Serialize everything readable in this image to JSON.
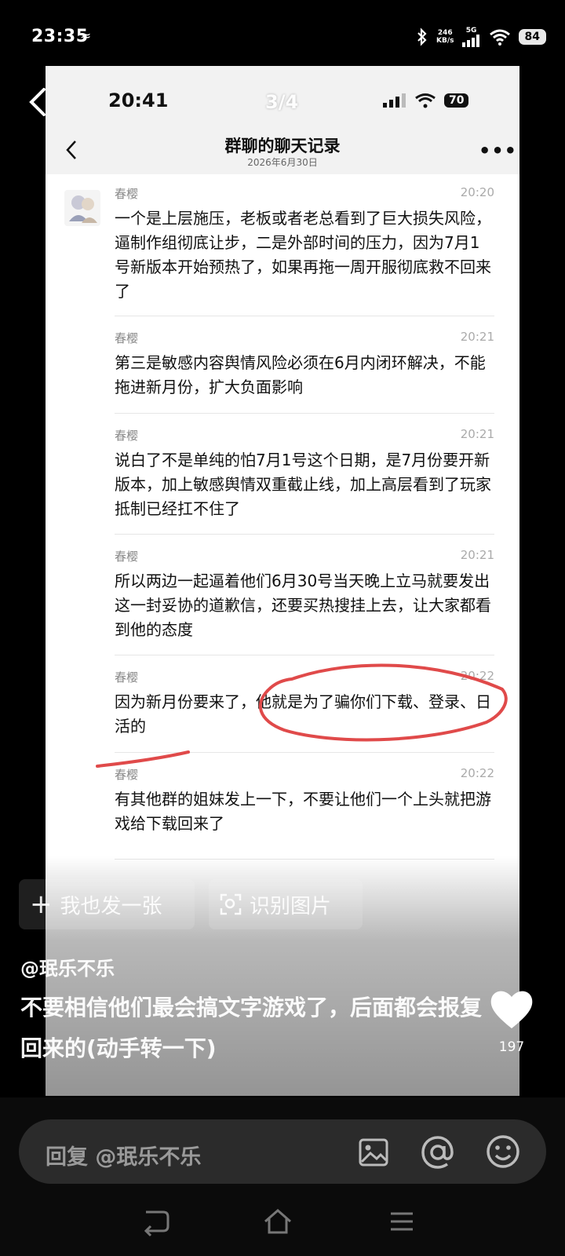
{
  "status_bar": {
    "time": "23:35",
    "flag": "≈",
    "speed_value": "246",
    "speed_unit": "KB/s",
    "network": "5G",
    "battery": "84"
  },
  "shot": {
    "status": {
      "time": "20:41",
      "battery": "70"
    },
    "page_indicator": "3/4",
    "title": "群聊的聊天记录",
    "date": "2026年6月30日",
    "messages": [
      {
        "name": "春樱",
        "time": "20:20",
        "text": "一个是上层施压，老板或者老总看到了巨大损失风险，逼制作组彻底让步，二是外部时间的压力，因为7月1号新版本开始预热了，如果再拖一周开服彻底救不回来了"
      },
      {
        "name": "春樱",
        "time": "20:21",
        "text": "第三是敏感内容舆情风险必须在6月内闭环解决，不能拖进新月份，扩大负面影响"
      },
      {
        "name": "春樱",
        "time": "20:21",
        "text": "说白了不是单纯的怕7月1号这个日期，是7月份要开新版本，加上敏感舆情双重截止线，加上高层看到了玩家抵制已经扛不住了"
      },
      {
        "name": "春樱",
        "time": "20:21",
        "text": "所以两边一起逼着他们6月30号当天晚上立马就要发出这一封妥协的道歉信，还要买热搜挂上去，让大家都看到他的态度"
      },
      {
        "name": "春樱",
        "time": "20:22",
        "text": "因为新月份要来了，他就是为了骗你们下载、登录、日活的"
      },
      {
        "name": "春樱",
        "time": "20:22",
        "text": "有其他群的姐妹发上一下，不要让他们一个上头就把游戏给下载回来了"
      }
    ]
  },
  "actions": {
    "post_label": "我也发一张",
    "recognize_label": "识别图片"
  },
  "post": {
    "author": "@珉乐不乐",
    "caption": "不要相信他们最会搞文字游戏了，后面都会报复回来的(动手转一下)",
    "likes": "197"
  },
  "reply": {
    "placeholder": "回复 @珉乐不乐"
  },
  "icons": [
    "back-icon",
    "bluetooth-icon",
    "signal-icon",
    "wifi-icon",
    "battery-icon",
    "more-icon",
    "plus-icon",
    "scan-icon",
    "heart-icon",
    "image-icon",
    "at-icon",
    "emoji-icon",
    "nav-back-icon",
    "nav-home-icon",
    "nav-menu-icon"
  ],
  "colors": {
    "annotation": "#e04a4a",
    "bottom_panel": "#0b0b0b",
    "reply_bar": "#2b2b2b"
  }
}
